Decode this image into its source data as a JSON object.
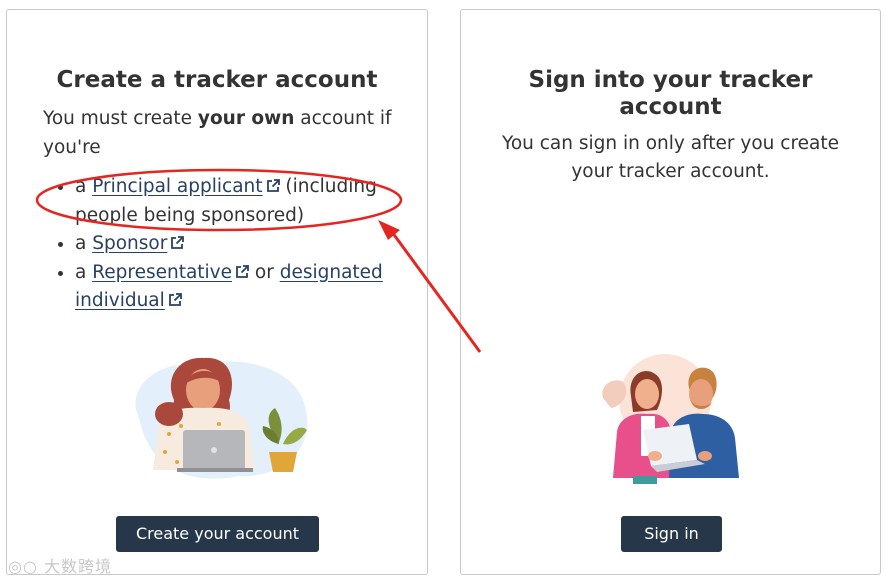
{
  "create_card": {
    "title": "Create a tracker account",
    "intro_before": "You must create ",
    "intro_bold": "your own",
    "intro_after": " account if you're",
    "roles": [
      {
        "prefix": "a ",
        "link": "Principal applicant",
        "suffix": " (including people being sponsored)"
      },
      {
        "prefix": "a ",
        "link": "Sponsor",
        "suffix": ""
      },
      {
        "prefix": "a ",
        "link": "Representative",
        "middle": " or ",
        "link2": "designated individual"
      }
    ],
    "button_label": "Create your account"
  },
  "signin_card": {
    "title": "Sign into your tracker account",
    "intro": "You can sign in only after you create your tracker account.",
    "button_label": "Sign in"
  },
  "icons": {
    "external_link": "external-link-icon",
    "illustration_left": "woman-with-laptop-illustration",
    "illustration_right": "couple-with-laptop-illustration"
  },
  "colors": {
    "button_bg": "#26374a",
    "link": "#284162",
    "annotation": "#e52620"
  },
  "watermark": "大数跨境"
}
